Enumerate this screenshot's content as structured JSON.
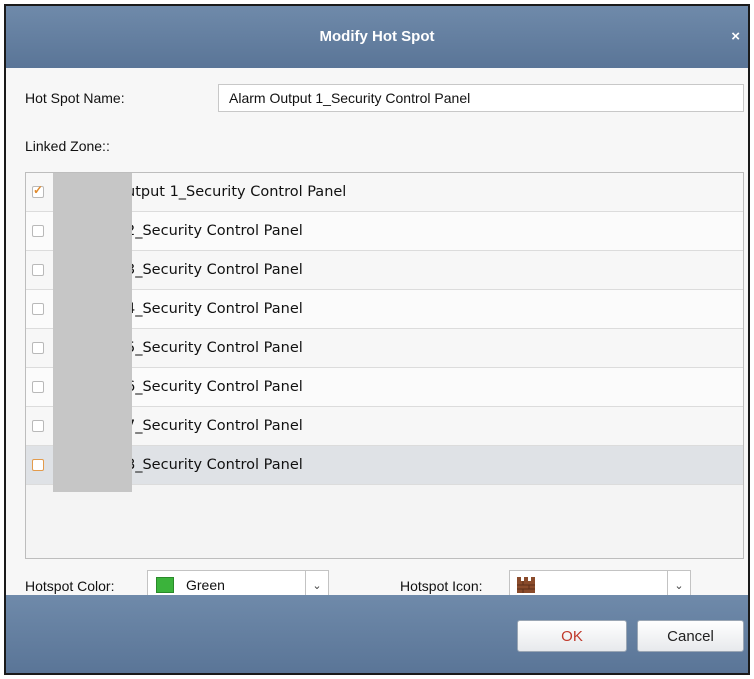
{
  "dialog": {
    "title": "Modify Hot Spot",
    "close_glyph": "×"
  },
  "form": {
    "name_label": "Hot Spot Name:",
    "name_value": "Alarm Output 1_Security Control Panel",
    "linked_zone_label": "Linked Zone::"
  },
  "zones": [
    {
      "label": "utput 1_Security Control Panel",
      "checked": true
    },
    {
      "label": "2_Security Control Panel",
      "checked": false
    },
    {
      "label": "3_Security Control Panel",
      "checked": false
    },
    {
      "label": "4_Security Control Panel",
      "checked": false
    },
    {
      "label": "5_Security Control Panel",
      "checked": false
    },
    {
      "label": "6_Security Control Panel",
      "checked": false
    },
    {
      "label": "7_Security Control Panel",
      "checked": false
    },
    {
      "label": "8_Security Control Panel",
      "checked": false
    }
  ],
  "hotspot_color": {
    "label": "Hotspot Color:",
    "value": "Green",
    "swatch_color": "#3bb33b"
  },
  "hotspot_icon": {
    "label": "Hotspot Icon:",
    "icon": "brick-wall-icon"
  },
  "buttons": {
    "ok": "OK",
    "cancel": "Cancel"
  }
}
